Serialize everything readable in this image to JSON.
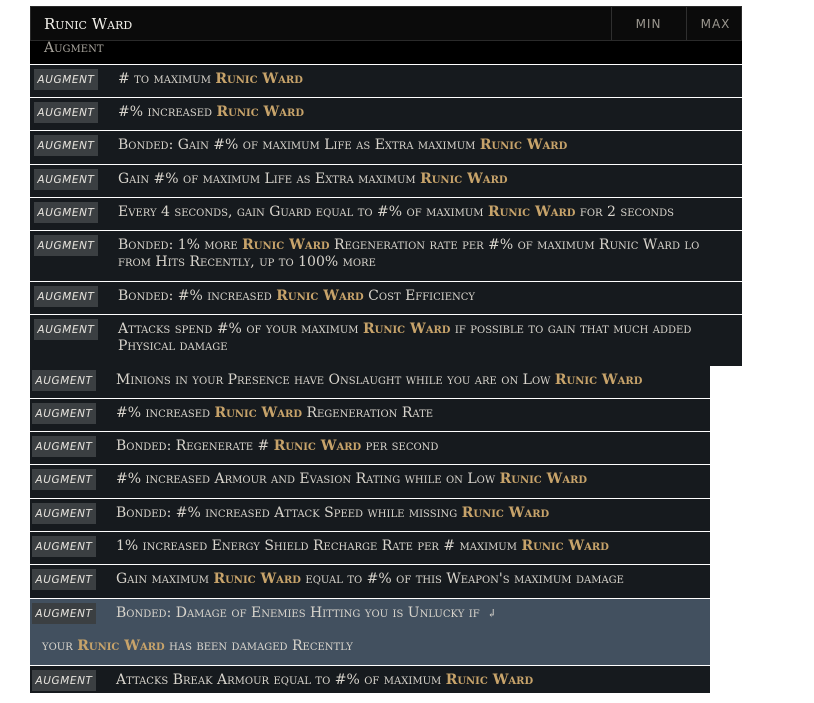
{
  "search": {
    "value": "Runic Ward",
    "min_label": "MIN",
    "max_label": "MAX"
  },
  "group_header": "Augment",
  "tag_label": "AUGMENT",
  "results": [
    {
      "parts": [
        [
          "# to maximum ",
          0
        ],
        [
          "Runic Ward",
          1
        ]
      ]
    },
    {
      "parts": [
        [
          "#% increased ",
          0
        ],
        [
          "Runic Ward",
          1
        ]
      ]
    },
    {
      "parts": [
        [
          "Bonded: Gain #% of maximum Life as Extra maximum ",
          0
        ],
        [
          "Runic Ward",
          1
        ]
      ]
    },
    {
      "parts": [
        [
          "Gain #% of maximum Life as Extra maximum ",
          0
        ],
        [
          "Runic Ward",
          1
        ]
      ]
    },
    {
      "parts": [
        [
          "Every 4 seconds, gain Guard equal to #% of maximum ",
          0
        ],
        [
          "Runic Ward",
          1
        ],
        [
          " for 2 seconds",
          0
        ]
      ]
    },
    {
      "parts": [
        [
          "Bonded: 1% more ",
          0
        ],
        [
          "Runic Ward",
          1
        ],
        [
          " Regeneration rate per #% of maximum Runic Ward lo",
          0
        ]
      ],
      "line2": "from Hits Recently, up to 100% more"
    },
    {
      "parts": [
        [
          "Bonded: #% increased ",
          0
        ],
        [
          "Runic Ward",
          1
        ],
        [
          " Cost Efficiency",
          0
        ]
      ]
    },
    {
      "parts": [
        [
          "Attacks spend #% of your maximum ",
          0
        ],
        [
          "Runic Ward",
          1
        ],
        [
          " if possible to gain that much added",
          0
        ]
      ],
      "line2": "Physical damage"
    },
    {
      "parts": [
        [
          "Minions in your Presence have Onslaught while you are on Low ",
          0
        ],
        [
          "Runic Ward",
          1
        ]
      ]
    },
    {
      "parts": [
        [
          "#% increased ",
          0
        ],
        [
          "Runic Ward",
          1
        ],
        [
          " Regeneration Rate",
          0
        ]
      ]
    },
    {
      "parts": [
        [
          "Bonded: Regenerate # ",
          0
        ],
        [
          "Runic Ward",
          1
        ],
        [
          " per second",
          0
        ]
      ]
    },
    {
      "parts": [
        [
          "#% increased Armour and Evasion Rating while on Low ",
          0
        ],
        [
          "Runic Ward",
          1
        ]
      ]
    },
    {
      "parts": [
        [
          "Bonded: #% increased Attack Speed while missing ",
          0
        ],
        [
          "Runic Ward",
          1
        ]
      ]
    },
    {
      "parts": [
        [
          "1% increased Energy Shield Recharge Rate per # maximum ",
          0
        ],
        [
          "Runic Ward",
          1
        ]
      ]
    },
    {
      "parts": [
        [
          "Gain maximum ",
          0
        ],
        [
          "Runic Ward",
          1
        ],
        [
          " equal to #% of this Weapon's maximum damage",
          0
        ]
      ]
    },
    {
      "parts": [
        [
          "Bonded: Damage of Enemies Hitting you is Unlucky if ",
          0
        ]
      ],
      "enter_icon": "return-arrow-icon",
      "cont_parts": [
        [
          "your ",
          0
        ],
        [
          "Runic Ward",
          1
        ],
        [
          " has been damaged Recently",
          0
        ]
      ],
      "highlight": true
    },
    {
      "parts": [
        [
          "Attacks Break Armour equal to #% of maximum ",
          0
        ],
        [
          "Runic Ward",
          1
        ]
      ]
    }
  ],
  "colors": {
    "keyword": "#c7a36a",
    "row_bg": "#161a1e",
    "highlight_bg": "#42505f",
    "tag_bg": "#3b3f42"
  }
}
